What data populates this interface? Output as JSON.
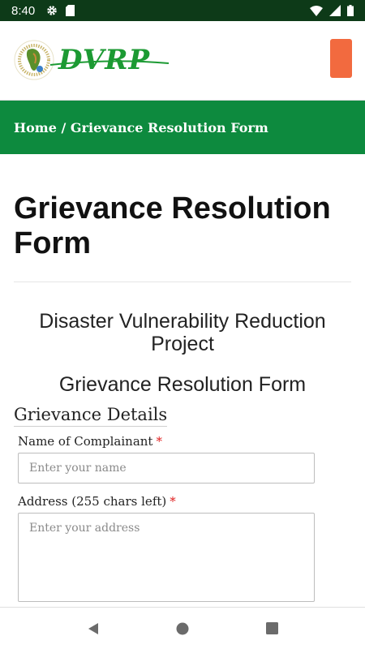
{
  "status_bar": {
    "time": "8:40",
    "icons": [
      "gear-icon",
      "sd-card-icon",
      "wifi-icon",
      "signal-icon",
      "battery-icon"
    ]
  },
  "header": {
    "logo_text": "DVRP",
    "menu_button_color": "#f26a3f"
  },
  "breadcrumb": {
    "home": "Home",
    "separator": " / ",
    "current": "Grievance Resolution Form"
  },
  "page": {
    "title": "Grievance Resolution Form",
    "project_name": "Disaster Vulnerability Reduction Project",
    "form_title": "Grievance Resolution Form"
  },
  "form": {
    "section_title": "Grievance Details",
    "name_label": "Name of Complainant",
    "name_placeholder": "Enter your name",
    "name_value": "",
    "address_label": "Address (255 chars left)",
    "address_placeholder": "Enter your address",
    "address_value": "",
    "required_marker": "*"
  },
  "nav": {
    "icons": [
      "back-icon",
      "home-icon",
      "recents-icon"
    ]
  },
  "colors": {
    "status_bar": "#0d3a18",
    "breadcrumb_bar": "#0d8a3e",
    "brand_green": "#1c9a33",
    "required": "#e02020"
  }
}
